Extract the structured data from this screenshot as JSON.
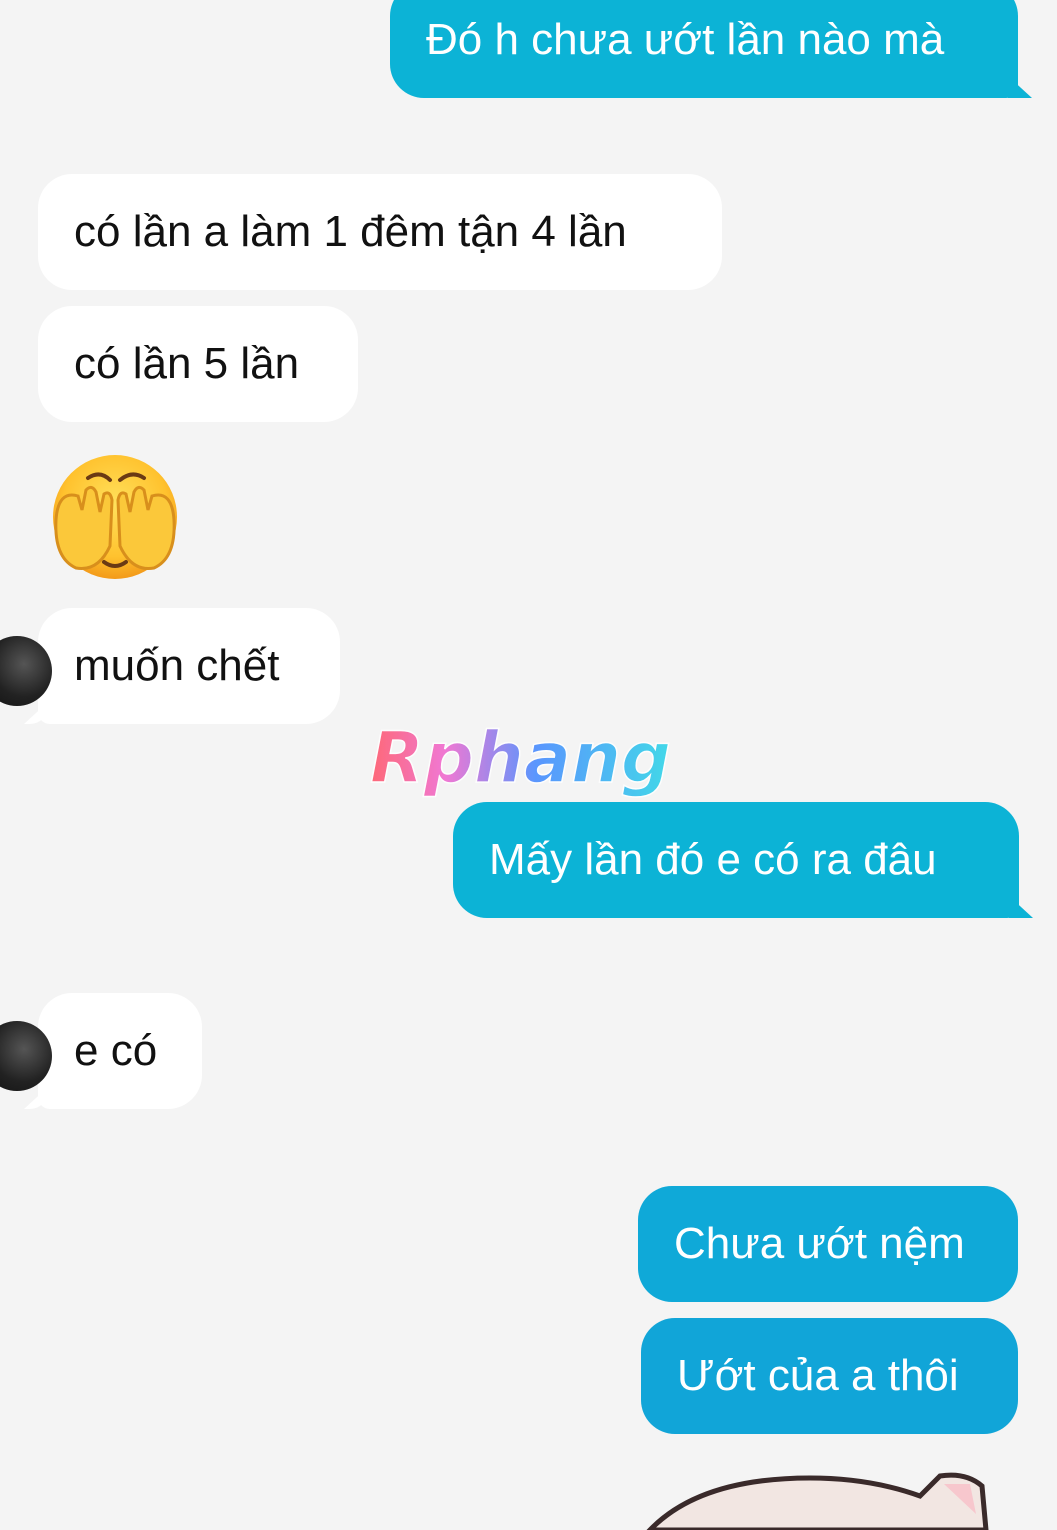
{
  "messages": [
    {
      "direction": "outgoing",
      "text": "Đó h chưa ướt lần nào mà"
    },
    {
      "direction": "incoming",
      "text": "có lần a làm 1 đêm tận 4 lần"
    },
    {
      "direction": "incoming",
      "text": "có lần 5 lần"
    },
    {
      "direction": "incoming",
      "type": "emoji",
      "emoji": "face-with-hands-over-eyes"
    },
    {
      "direction": "incoming",
      "text": "muốn chết"
    },
    {
      "direction": "outgoing",
      "text": "Mấy lần đó e có ra đâu"
    },
    {
      "direction": "incoming",
      "text": "e có"
    },
    {
      "direction": "outgoing",
      "text": "Chưa ướt nệm"
    },
    {
      "direction": "outgoing",
      "text": "Ướt của a thôi"
    },
    {
      "direction": "outgoing",
      "type": "sticker",
      "sticker": "cat-sticker"
    }
  ],
  "watermark": {
    "text": "Rphang"
  },
  "colors": {
    "background": "#f4f4f4",
    "incoming_bubble": "#ffffff",
    "outgoing_bubble": "#0cb3d6",
    "outgoing_bubble_alt": "#11a5d8"
  }
}
